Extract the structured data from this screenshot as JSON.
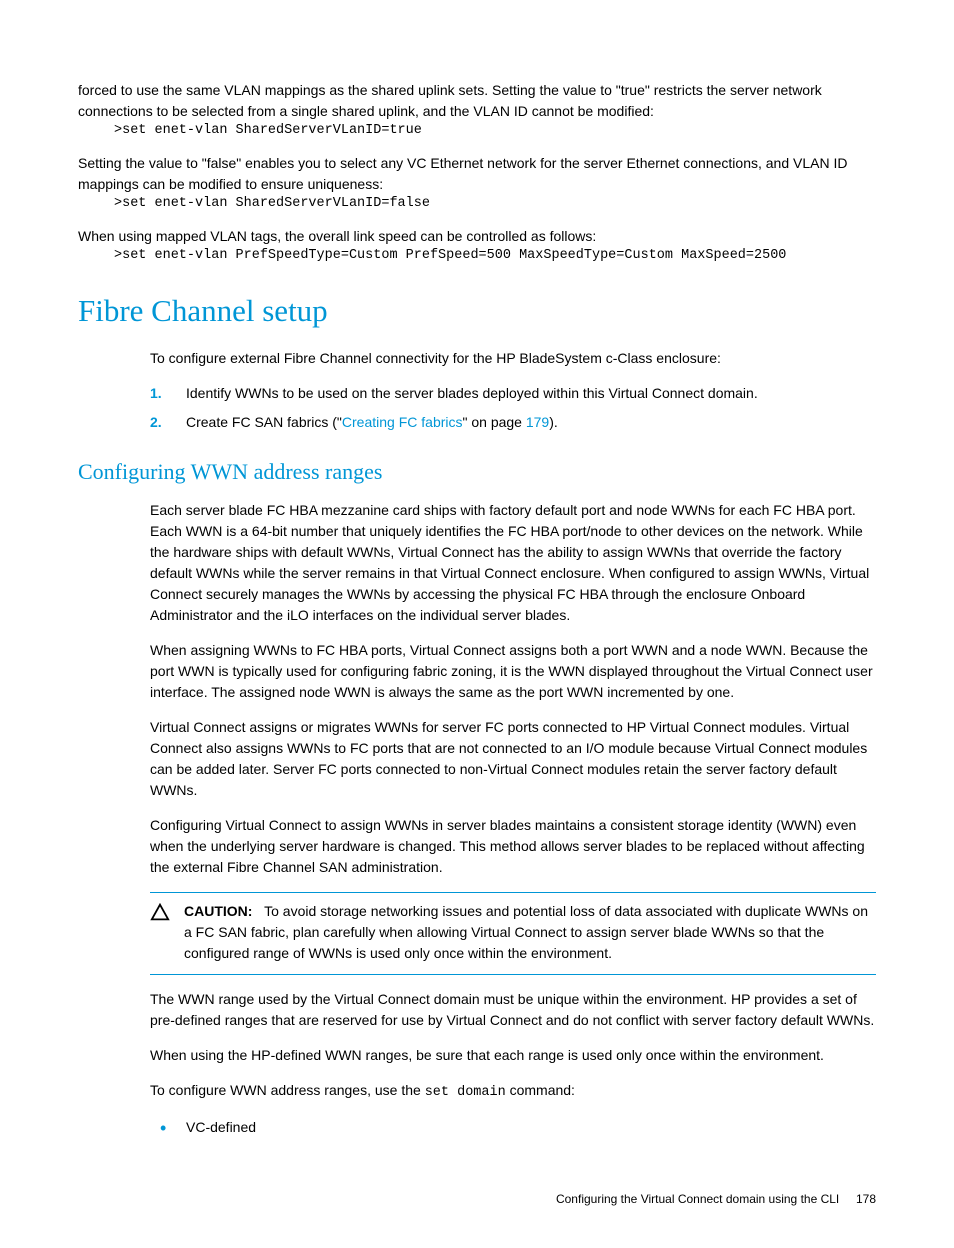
{
  "top": {
    "para1": "forced to use the same VLAN mappings as the shared uplink sets. Setting the value to \"true\" restricts the server network connections to be selected from a single shared uplink, and the VLAN ID cannot be modified:",
    "code1": ">set enet-vlan SharedServerVLanID=true",
    "para2": "Setting the value to \"false\" enables you to select any VC Ethernet network for the server Ethernet connections, and VLAN ID mappings can be modified to ensure uniqueness:",
    "code2": ">set enet-vlan SharedServerVLanID=false",
    "para3": "When using mapped VLAN tags, the overall link speed can be controlled as follows:",
    "code3": ">set enet-vlan PrefSpeedType=Custom PrefSpeed=500 MaxSpeedType=Custom MaxSpeed=2500"
  },
  "h1": "Fibre Channel setup",
  "fc_intro": "To configure external Fibre Channel connectivity for the HP BladeSystem c-Class enclosure:",
  "ol": {
    "item1_num": "1.",
    "item1": "Identify WWNs to be used on the server blades deployed within this Virtual Connect domain.",
    "item2_num": "2.",
    "item2_prefix": "Create FC SAN fabrics (\"",
    "item2_link": "Creating FC fabrics",
    "item2_mid": "\" on page ",
    "item2_page": "179",
    "item2_suffix": ")."
  },
  "h2": "Configuring WWN address ranges",
  "wwn": {
    "p1": "Each server blade FC HBA mezzanine card ships with factory default port and node WWNs for each FC HBA port. Each WWN is a 64-bit number that uniquely identifies the FC HBA port/node to other devices on the network. While the hardware ships with default WWNs, Virtual Connect has the ability to assign WWNs that override the factory default WWNs while the server remains in that Virtual Connect enclosure. When configured to assign WWNs, Virtual Connect securely manages the WWNs by accessing the physical FC HBA through the enclosure Onboard Administrator and the iLO interfaces on the individual server blades.",
    "p2": "When assigning WWNs to FC HBA ports, Virtual Connect assigns both a port WWN and a node WWN. Because the port WWN is typically used for configuring fabric zoning, it is the WWN displayed throughout the Virtual Connect user interface. The assigned node WWN is always the same as the port WWN incremented by one.",
    "p3": "Virtual Connect assigns or migrates WWNs for server FC ports connected to HP Virtual Connect modules. Virtual Connect also assigns WWNs to FC ports that are not connected to an I/O module because Virtual Connect modules can be added later. Server FC ports connected to non-Virtual Connect modules retain the server factory default WWNs.",
    "p4": "Configuring Virtual Connect to assign WWNs in server blades maintains a consistent storage identity (WWN) even when the underlying server hardware is changed. This method allows server blades to be replaced without affecting the external Fibre Channel SAN administration."
  },
  "caution": {
    "label": "CAUTION:",
    "text": "To avoid storage networking issues and potential loss of data associated with duplicate WWNs on a FC SAN fabric, plan carefully when allowing Virtual Connect to assign server blade WWNs so that the configured range of WWNs is used only once within the environment."
  },
  "after_caution": {
    "p1": "The WWN range used by the Virtual Connect domain must be unique within the environment. HP provides a set of pre-defined ranges that are reserved for use by Virtual Connect and do not conflict with server factory default WWNs.",
    "p2": "When using the HP-defined WWN ranges, be sure that each range is used only once within the environment.",
    "p3_prefix": "To configure WWN address ranges, use the ",
    "p3_cmd": "set domain",
    "p3_suffix": " command:"
  },
  "bullet1": "VC-defined",
  "footer": {
    "text": "Configuring the Virtual Connect domain using the CLI",
    "page": "178"
  }
}
